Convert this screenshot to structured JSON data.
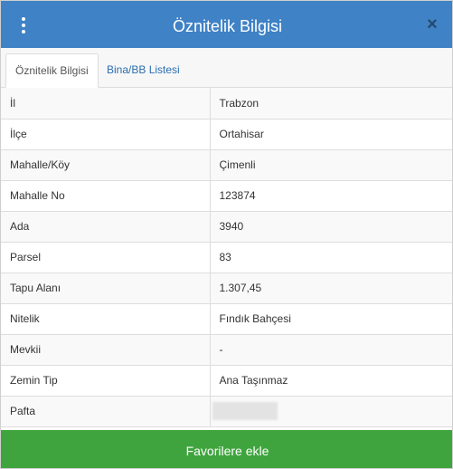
{
  "header": {
    "title": "Öznitelik Bilgisi",
    "accent_color": "#3f82c6",
    "menu_icon": "kebab-menu-icon",
    "close_icon": "close-icon",
    "close_glyph": "×"
  },
  "tabs": [
    {
      "label": "Öznitelik Bilgisi",
      "active": true
    },
    {
      "label": "Bina/BB Listesi",
      "active": false
    }
  ],
  "attributes": [
    {
      "key": "İl",
      "value": "Trabzon"
    },
    {
      "key": "İlçe",
      "value": "Ortahisar"
    },
    {
      "key": "Mahalle/Köy",
      "value": "Çimenli"
    },
    {
      "key": "Mahalle No",
      "value": "123874"
    },
    {
      "key": "Ada",
      "value": "3940"
    },
    {
      "key": "Parsel",
      "value": "83"
    },
    {
      "key": "Tapu Alanı",
      "value": "1.307,45"
    },
    {
      "key": "Nitelik",
      "value": "Fındık Bahçesi"
    },
    {
      "key": "Mevkii",
      "value": "-"
    },
    {
      "key": "Zemin Tip",
      "value": "Ana Taşınmaz"
    },
    {
      "key": "Pafta",
      "value": ""
    }
  ],
  "footer": {
    "favorite_label": "Favorilere ekle",
    "button_color": "#3fa43e"
  }
}
